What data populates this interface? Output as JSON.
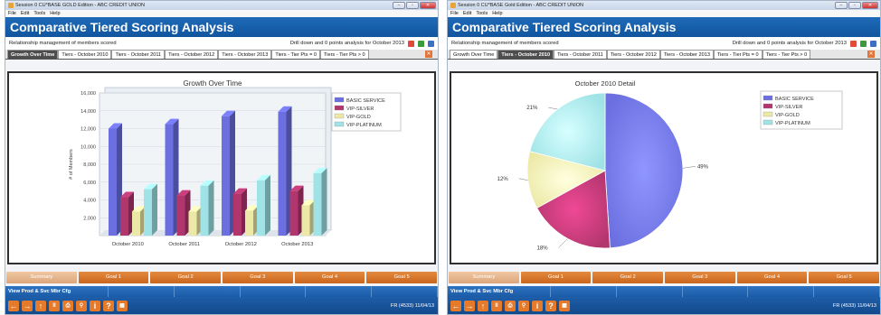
{
  "windows": [
    {
      "title": "Session 0 CU*BASE GOLD Edition - ABC CREDIT UNION",
      "menu": [
        "File",
        "Edit",
        "Tools",
        "Help"
      ],
      "window_controls": [
        "minimize-icon",
        "restore-icon",
        "close-icon"
      ],
      "header": "Comparative Tiered Scoring Analysis",
      "subtitle": "Relationship management of members scored",
      "drill_text": "Drill down and 0 points analysis for October 2013",
      "toolbar_icons": [
        "pdf-icon",
        "excel-icon",
        "save-icon"
      ],
      "tabs": [
        "Growth Over Time",
        "Tiers - October 2010",
        "Tiers - October 2011",
        "Tiers - October 2012",
        "Tiers - October 2013",
        "Tiers - Tier Pts = 0",
        "Tiers - Tier Pts > 0"
      ],
      "active_tab": 0,
      "goals": [
        "Summary",
        "Goal 1",
        "Goal 2",
        "Goal 3",
        "Goal 4",
        "Goal 5"
      ],
      "bottom_bar": [
        "View Prod & Svc Mbr Cfg",
        "",
        "",
        "",
        "",
        "",
        ""
      ],
      "nav_status": "FR (4533) 11/04/13"
    },
    {
      "title": "Session 0 CU*BASE Gold Edition - ABC CREDIT UNION",
      "menu": [
        "File",
        "Edit",
        "Tools",
        "Help"
      ],
      "window_controls": [
        "minimize-icon",
        "restore-icon",
        "close-icon"
      ],
      "header": "Comparative Tiered Scoring Analysis",
      "subtitle": "Relationship management of members scored",
      "drill_text": "Drill down and 0 points analysis for October 2013",
      "toolbar_icons": [
        "pdf-icon",
        "excel-icon",
        "save-icon"
      ],
      "tabs": [
        "Growth Over Time",
        "Tiers - October 2010",
        "Tiers - October 2011",
        "Tiers - October 2012",
        "Tiers - October 2013",
        "Tiers - Tier Pts = 0",
        "Tiers - Tier Pts > 0"
      ],
      "active_tab": 1,
      "goals": [
        "Summary",
        "Goal 1",
        "Goal 2",
        "Goal 3",
        "Goal 4",
        "Goal 5"
      ],
      "bottom_bar": [
        "View Prod & Svc Mbr Cfg",
        "",
        "",
        "",
        "",
        "",
        ""
      ],
      "nav_status": "FR (4533) 11/04/13"
    }
  ],
  "colors": {
    "basic_service": "#6b6fe0",
    "vip_silver": "#b2366e",
    "vip_gold": "#ece9a6",
    "vip_platinum": "#9fe3e6",
    "header_blue": "#1a64b2",
    "goal_orange": "#d8762a"
  },
  "chart_data": [
    {
      "type": "bar",
      "title": "Growth Over Time",
      "ylabel": "# of Members",
      "xlabel": "",
      "ylim": [
        0,
        16000
      ],
      "yticks": [
        "2,000",
        "4,000",
        "6,000",
        "8,000",
        "10,000",
        "12,000",
        "14,000",
        "16,000"
      ],
      "categories": [
        "October 2010",
        "October 2011",
        "October 2012",
        "October 2013"
      ],
      "series": [
        {
          "name": "BASIC SERVICE",
          "values": [
            12000,
            12500,
            13400,
            13900
          ]
        },
        {
          "name": "VIP-SILVER",
          "values": [
            4300,
            4500,
            4700,
            5000
          ]
        },
        {
          "name": "VIP-GOLD",
          "values": [
            2700,
            2700,
            2800,
            3400
          ]
        },
        {
          "name": "VIP-PLATINUM",
          "values": [
            5200,
            5600,
            6200,
            7000
          ]
        }
      ],
      "legend": "top-right",
      "grid": true
    },
    {
      "type": "pie",
      "title": "October 2010 Detail",
      "categories": [
        "BASIC SERVICE",
        "VIP-SILVER",
        "VIP-GOLD",
        "VIP-PLATINUM"
      ],
      "values": [
        49,
        18,
        12,
        21
      ],
      "labels": [
        "49%",
        "18%",
        "12%",
        "21%"
      ],
      "legend": "top-right"
    }
  ]
}
